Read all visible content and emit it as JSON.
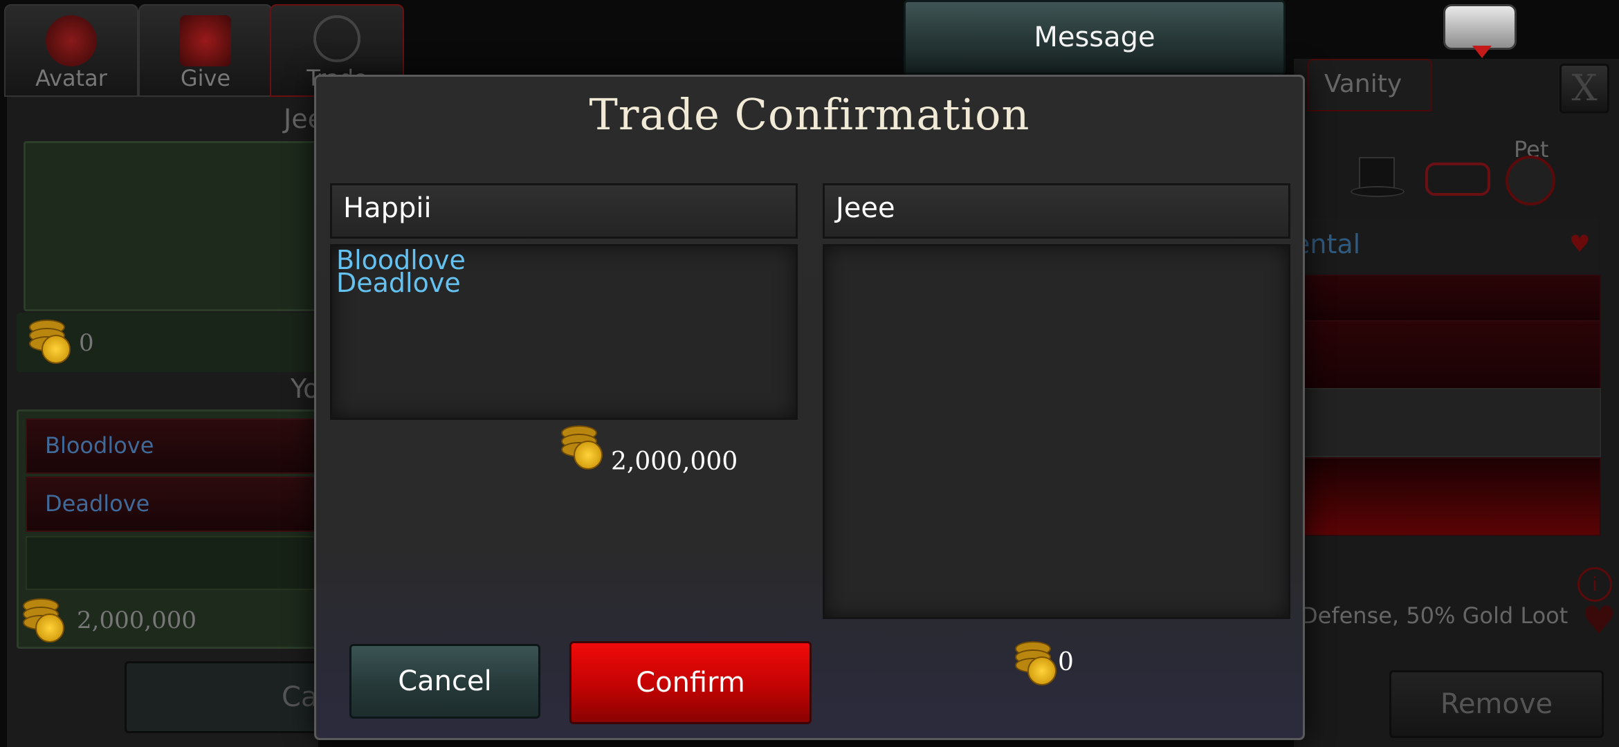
{
  "background": {
    "tabs": [
      {
        "label": "Avatar",
        "icon": "avatar-icon"
      },
      {
        "label": "Give",
        "icon": "gift-icon"
      },
      {
        "label": "Trade",
        "icon": "scales-icon"
      }
    ],
    "partner_heading_partial": "Jee",
    "partner_gold": "0",
    "you_heading_partial": "Yo",
    "my_items": [
      "Bloodlove",
      "Deadlove"
    ],
    "my_gold": "2,000,000",
    "cancel_partial": "Car",
    "message_button": "Message",
    "vanity_tab": "Vanity",
    "pet_label": "Pet",
    "ental_partial": "ental",
    "defense_text": "Defense, 50% Gold Loot",
    "remove_button": "Remove",
    "close_label": "X"
  },
  "modal": {
    "title": "Trade Confirmation",
    "left": {
      "player": "Happii",
      "items": [
        "Bloodlove",
        "Deadlove"
      ],
      "gold": "2,000,000"
    },
    "right": {
      "player": "Jeee",
      "items": [],
      "gold": "0"
    },
    "cancel_label": "Cancel",
    "confirm_label": "Confirm"
  },
  "colors": {
    "item_text": "#65c1f0",
    "confirm_red": "#e00808",
    "cancel_teal": "#2f4646"
  }
}
